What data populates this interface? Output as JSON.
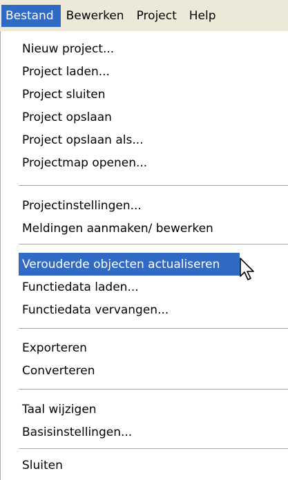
{
  "menubar": {
    "items": [
      {
        "label": "Bestand"
      },
      {
        "label": "Bewerken"
      },
      {
        "label": "Project"
      },
      {
        "label": "Help"
      }
    ]
  },
  "menu": {
    "groups": [
      {
        "items": [
          "Nieuw project...",
          "Project laden...",
          "Project sluiten",
          "Project opslaan",
          "Project opslaan als...",
          "Projectmap openen..."
        ]
      },
      {
        "items": [
          "Projectinstellingen...",
          "Meldingen aanmaken/ bewerken"
        ]
      },
      {
        "items": [
          "Verouderde objecten actualiseren",
          "Functiedata laden...",
          "Functiedata vervangen..."
        ]
      },
      {
        "items": [
          "Exporteren",
          "Converteren"
        ]
      },
      {
        "items": [
          "Taal wijzigen",
          "Basisinstellingen..."
        ]
      },
      {
        "items": [
          "Sluiten"
        ]
      }
    ],
    "highlighted_item": "Verouderde objecten actualiseren"
  },
  "colors": {
    "highlight": "#316ac5",
    "menubar_bg": "#ece9d8",
    "separator": "#a7a7a7"
  },
  "cursor": {
    "icon": "mouse-pointer-icon"
  }
}
